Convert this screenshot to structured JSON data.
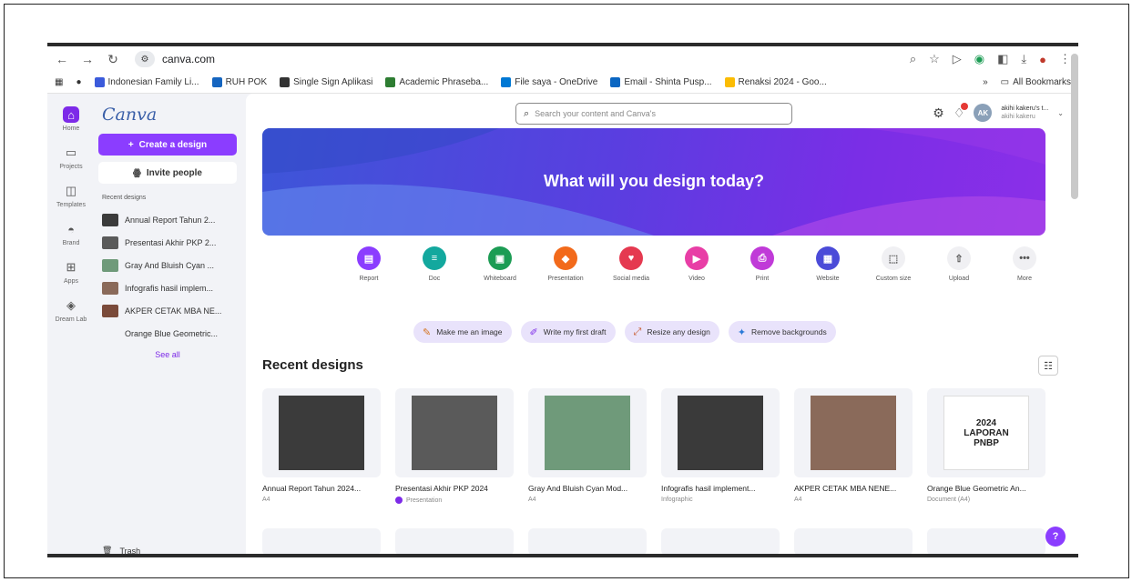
{
  "browser": {
    "url": "canva.com",
    "bookmarks": [
      {
        "label": "Indonesian Family Li...",
        "color": "#3b5bdb"
      },
      {
        "label": "RUH POK",
        "color": "#1565c0"
      },
      {
        "label": "Single Sign Aplikasi",
        "color": "#333333"
      },
      {
        "label": "Academic Phraseba...",
        "color": "#2e7d32"
      },
      {
        "label": "File saya - OneDrive",
        "color": "#0078d4"
      },
      {
        "label": "Email - Shinta Pusp...",
        "color": "#0a66c2"
      },
      {
        "label": "Renaksi 2024 - Goo...",
        "color": "#fbbc04"
      }
    ],
    "more_bookmarks": "»",
    "all_bookmarks": "All Bookmarks"
  },
  "rail": [
    {
      "label": "Home",
      "icon": "home-icon",
      "glyph": "⌂"
    },
    {
      "label": "Projects",
      "icon": "folder-icon",
      "glyph": "▭"
    },
    {
      "label": "Templates",
      "icon": "templates-icon",
      "glyph": "◫"
    },
    {
      "label": "Brand",
      "icon": "brand-icon",
      "glyph": "◓"
    },
    {
      "label": "Apps",
      "icon": "apps-icon",
      "glyph": "⊞"
    },
    {
      "label": "Dream Lab",
      "icon": "dream-lab-icon",
      "glyph": "◈"
    }
  ],
  "sidebar": {
    "logo": "Canva",
    "create_label": "Create a design",
    "invite_label": "Invite people",
    "recent_heading": "Recent designs",
    "recent_items": [
      "Annual Report Tahun 2...",
      "Presentasi Akhir PKP 2...",
      "Gray And Bluish Cyan ...",
      "Infografis hasil implem...",
      "AKPER CETAK MBA NE...",
      "Orange Blue Geometric..."
    ],
    "see_all": "See all",
    "trash": "Trash"
  },
  "topbar": {
    "search_placeholder": "Search your content and Canva's",
    "account_name": "akihi kakeru's t...",
    "account_sub": "akihi kakeru",
    "avatar_initials": "AK"
  },
  "hero": {
    "title": "What will you design today?"
  },
  "quick_actions": [
    {
      "label": "Report",
      "color": "#8b3dff",
      "glyph": "▤"
    },
    {
      "label": "Doc",
      "color": "#13a89e",
      "glyph": "≡"
    },
    {
      "label": "Whiteboard",
      "color": "#1c9c54",
      "glyph": "▣"
    },
    {
      "label": "Presentation",
      "color": "#f26a1b",
      "glyph": "◆"
    },
    {
      "label": "Social media",
      "color": "#e53950",
      "glyph": "♥"
    },
    {
      "label": "Video",
      "color": "#e83ea6",
      "glyph": "▶"
    },
    {
      "label": "Print",
      "color": "#c03ad8",
      "glyph": "⎙"
    },
    {
      "label": "Website",
      "color": "#4b4bd8",
      "glyph": "▦"
    },
    {
      "label": "Custom size",
      "color": "",
      "glyph": "⬚"
    },
    {
      "label": "Upload",
      "color": "",
      "glyph": "⇧"
    },
    {
      "label": "More",
      "color": "",
      "glyph": "•••"
    }
  ],
  "pills": [
    {
      "label": "Make me an image",
      "glyph": "✎"
    },
    {
      "label": "Write my first draft",
      "glyph": "✐"
    },
    {
      "label": "Resize any design",
      "glyph": "⤢"
    },
    {
      "label": "Remove backgrounds",
      "glyph": "✦"
    }
  ],
  "recent": {
    "title": "Recent designs",
    "cards": [
      {
        "title": "Annual Report Tahun 2024...",
        "sub": "A4",
        "thumb": "#3b3b3b"
      },
      {
        "title": "Presentasi Akhir PKP 2024",
        "sub": "Presentation",
        "thumb": "#5a5a5a"
      },
      {
        "title": "Gray And Bluish Cyan Mod...",
        "sub": "A4",
        "thumb": "#6f9a7a"
      },
      {
        "title": "Infografis hasil implement...",
        "sub": "Infographic",
        "thumb": "#3a3a3a"
      },
      {
        "title": "AKPER CETAK MBA NENE...",
        "sub": "A4",
        "thumb": "#8a6a5a"
      },
      {
        "title": "Orange Blue Geometric An...",
        "sub": "Document (A4)",
        "thumb": "#ffffff",
        "thumb_text": "2024 LAPORAN PNBP"
      }
    ]
  },
  "help_label": "?"
}
